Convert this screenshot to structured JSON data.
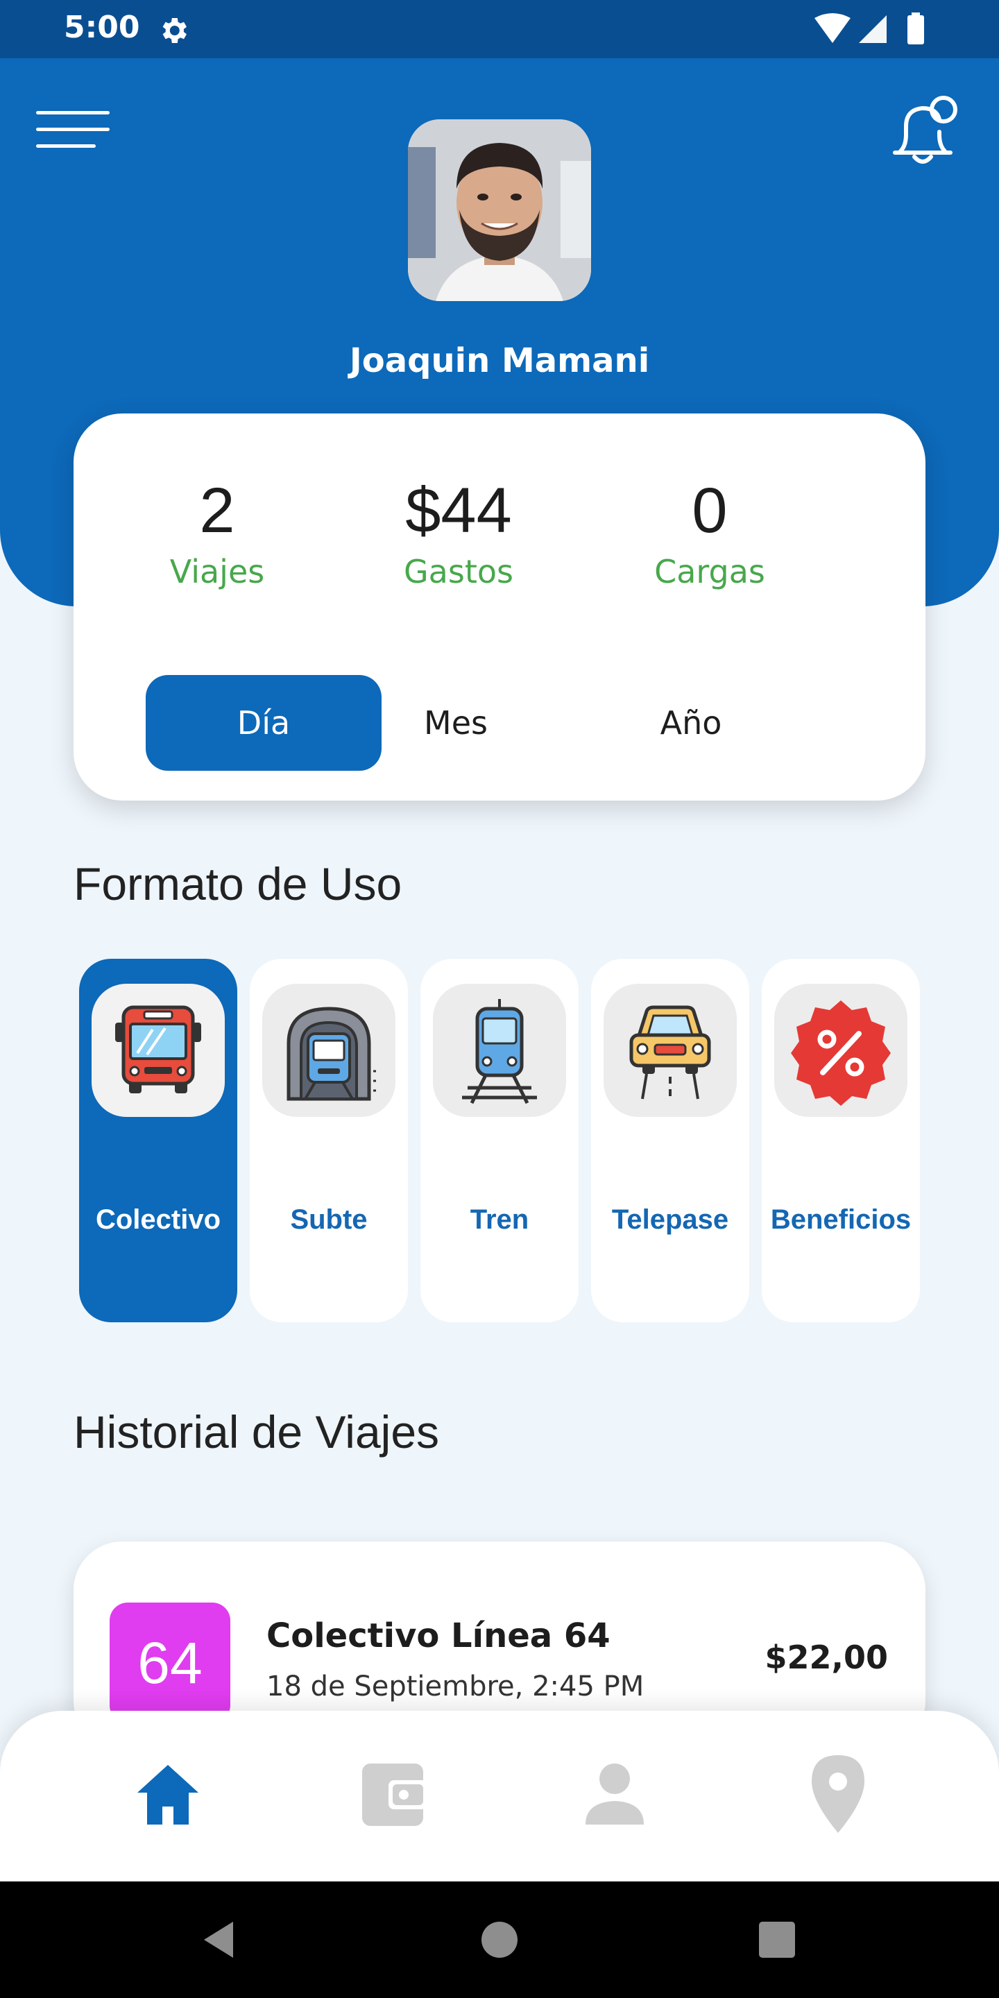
{
  "status_bar": {
    "time": "5:00",
    "icons": [
      "gear-icon",
      "wifi-icon",
      "signal-icon",
      "battery-icon"
    ]
  },
  "header": {
    "user_name": "Joaquin Mamani",
    "menu_icon": "hamburger-menu-icon",
    "notification_icon": "bell-icon"
  },
  "stats": {
    "items": [
      {
        "value": "2",
        "label": "Viajes"
      },
      {
        "value": "$44",
        "label": "Gastos"
      },
      {
        "value": "0",
        "label": "Cargas"
      }
    ],
    "periods": [
      {
        "label": "Día",
        "active": true
      },
      {
        "label": "Mes",
        "active": false
      },
      {
        "label": "Año",
        "active": false
      }
    ]
  },
  "usage": {
    "title": "Formato de Uso",
    "items": [
      {
        "label": "Colectivo",
        "icon": "bus-icon",
        "active": true
      },
      {
        "label": "Subte",
        "icon": "subway-icon",
        "active": false
      },
      {
        "label": "Tren",
        "icon": "train-icon",
        "active": false
      },
      {
        "label": "Telepase",
        "icon": "car-icon",
        "active": false
      },
      {
        "label": "Beneficios",
        "icon": "discount-badge-icon",
        "active": false
      }
    ]
  },
  "history": {
    "title": "Historial de Viajes",
    "trips": [
      {
        "badge": "64",
        "title": "Colectivo Línea 64",
        "date": "18 de Septiembre, 2:45 PM",
        "amount": "$22,00"
      }
    ]
  },
  "bottom_nav": {
    "items": [
      {
        "icon": "home-icon",
        "active": true
      },
      {
        "icon": "wallet-icon",
        "active": false
      },
      {
        "icon": "person-icon",
        "active": false
      },
      {
        "icon": "location-pin-icon",
        "active": false
      }
    ]
  },
  "colors": {
    "primary": "#0d69b9",
    "status_bar": "#0a4e92",
    "stat_label": "#47a84b",
    "badge": "#e03cf0",
    "background": "#eef5fb"
  }
}
